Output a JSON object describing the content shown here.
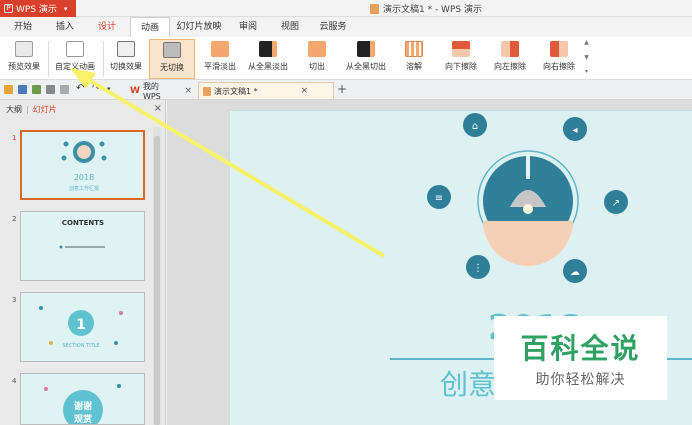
{
  "app": {
    "name": "WPS 演示",
    "window_title": "演示文稿1 * - WPS 演示"
  },
  "menu_tabs": [
    "开始",
    "插入",
    "设计",
    "动画",
    "幻灯片放映",
    "审阅",
    "视图",
    "云服务"
  ],
  "ribbon": {
    "buttons": [
      "预览效果",
      "自定义动画",
      "切换效果",
      "无切换",
      "平滑淡出",
      "从全黑淡出",
      "切出",
      "从全黑切出",
      "溶解",
      "向下擦除",
      "向左擦除",
      "向右擦除"
    ]
  },
  "doc_tabs": {
    "home": "我的WPS",
    "current": "演示文稿1 *"
  },
  "panel": {
    "outline": "大纲",
    "slides": "幻灯片",
    "thumbnails": [
      {
        "num": "1",
        "year": "2018",
        "subtitle": "创意工作汇报"
      },
      {
        "num": "2",
        "title": "CONTENTS"
      },
      {
        "num": "3",
        "big": "1",
        "caption": "SECTION TITLE"
      },
      {
        "num": "4",
        "line1": "谢谢",
        "line2": "观赏"
      }
    ]
  },
  "slide": {
    "year": "2018",
    "title_fragment": "创意"
  },
  "watermark": {
    "main": "百科全说",
    "sub": "助你轻松解决"
  },
  "colors": {
    "brand_red": "#d9402b",
    "teal": "#3a8fa8",
    "annotation_arrow": "#f7f26a",
    "watermark_green": "#2ea163"
  }
}
